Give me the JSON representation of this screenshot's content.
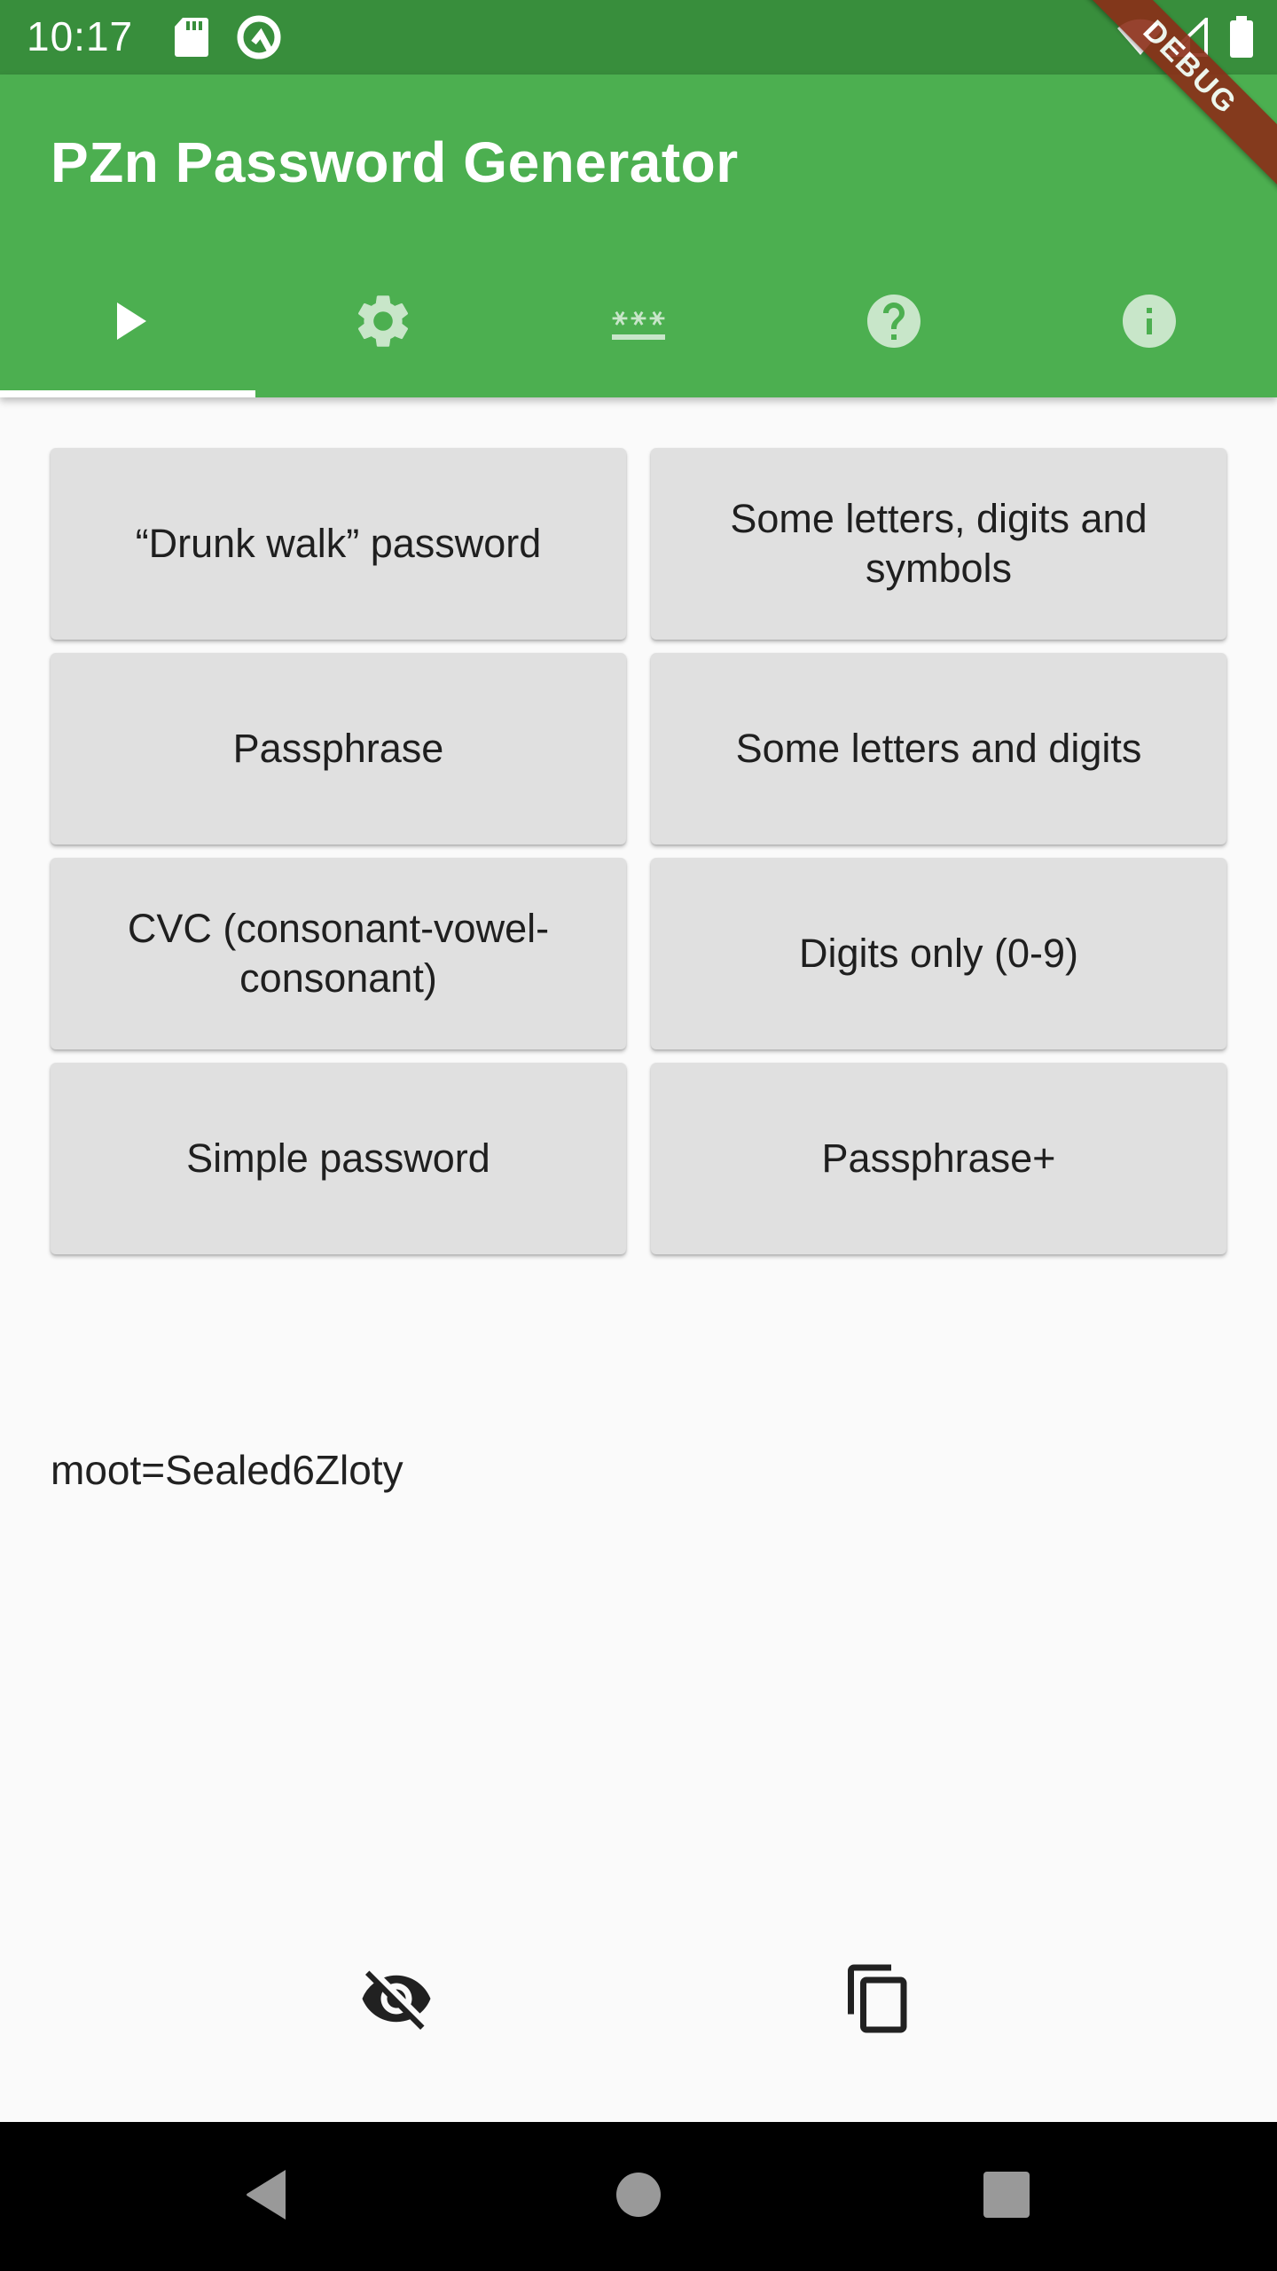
{
  "status_bar": {
    "time": "10:17",
    "left_icons": [
      "sd-card-icon",
      "android-q-icon"
    ],
    "right_icons": [
      "wifi-icon",
      "cellular-signal-icon",
      "battery-icon"
    ]
  },
  "debug_banner": "DEBUG",
  "app_bar": {
    "title": "PZn Password Generator",
    "background_color": "#4caf50",
    "status_bar_color": "#388e3c"
  },
  "tabs": [
    {
      "icon": "play-icon",
      "selected": true
    },
    {
      "icon": "gear-icon",
      "selected": false
    },
    {
      "icon": "password-icon",
      "selected": false
    },
    {
      "icon": "help-icon",
      "selected": false
    },
    {
      "icon": "info-icon",
      "selected": false
    }
  ],
  "generator_buttons": [
    {
      "label": "“Drunk walk” password"
    },
    {
      "label": "Some letters, digits and symbols"
    },
    {
      "label": "Passphrase"
    },
    {
      "label": "Some letters and digits"
    },
    {
      "label": "CVC (consonant-vowel-consonant)"
    },
    {
      "label": "Digits only (0-9)"
    },
    {
      "label": "Simple password"
    },
    {
      "label": "Passphrase+"
    }
  ],
  "output": {
    "password": "moot=Sealed6Zloty"
  },
  "actions": [
    {
      "icon": "visibility-off-icon"
    },
    {
      "icon": "copy-icon"
    }
  ],
  "nav_bar": [
    "back-icon",
    "home-icon",
    "recents-icon"
  ]
}
